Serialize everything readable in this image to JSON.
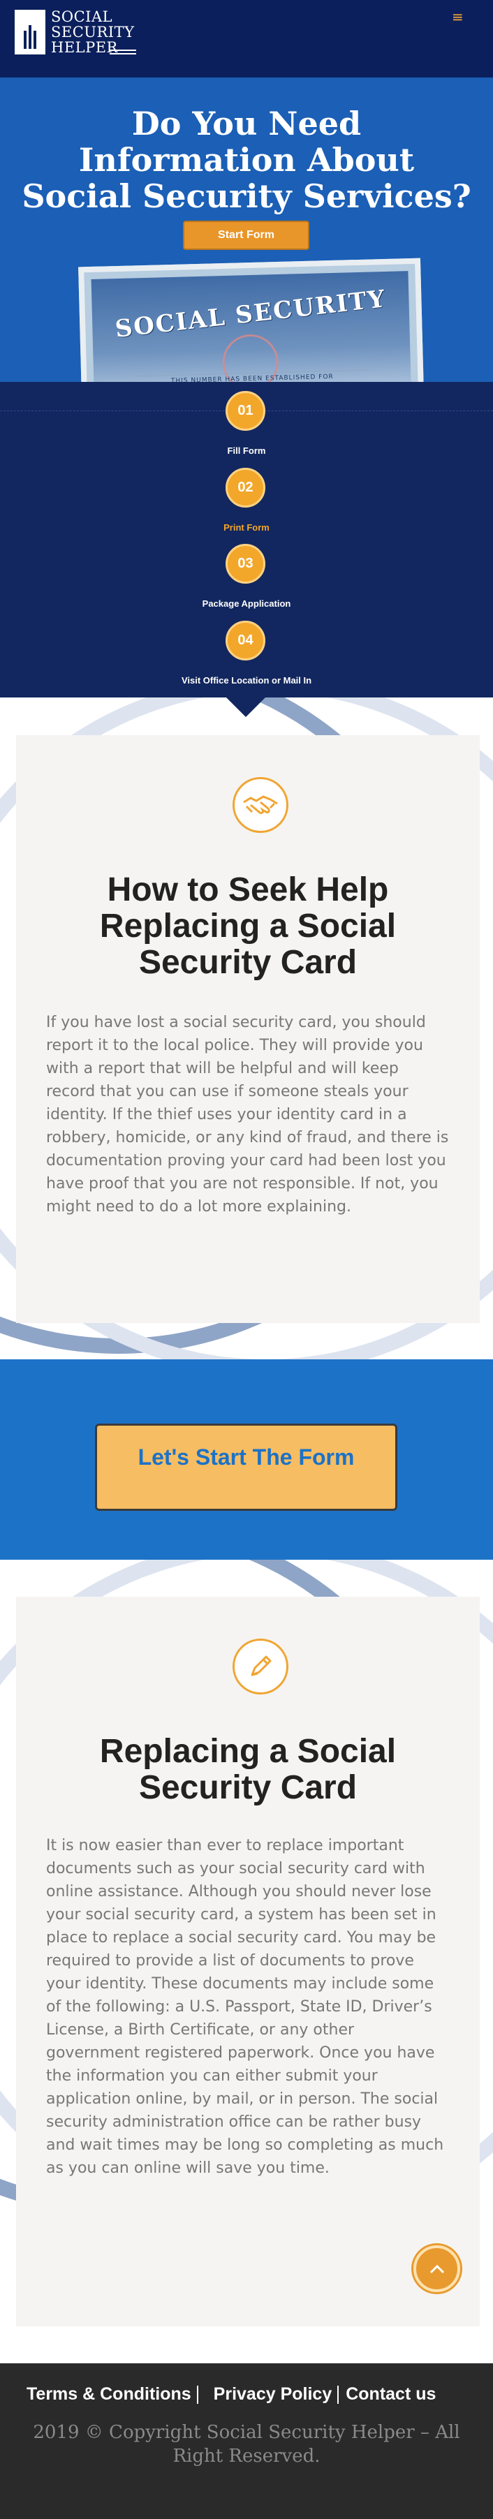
{
  "header": {
    "logo_line1": "SOCIAL",
    "logo_line2": "SECURITY",
    "logo_line3": "HELPER",
    "menu_icon": "≡"
  },
  "hero": {
    "title": "Do You Need Information About Social Security Services?",
    "start_button": "Start Form",
    "card_title": "SOCIAL SECURITY",
    "card_text": "THIS NUMBER HAS BEEN ESTABLISHED FOR"
  },
  "steps": [
    {
      "number": "01",
      "label": "Fill Form",
      "active": false
    },
    {
      "number": "02",
      "label": "Print Form",
      "active": true
    },
    {
      "number": "03",
      "label": "Package Application",
      "active": false
    },
    {
      "number": "04",
      "label": "Visit Office Location or Mail In",
      "active": false
    }
  ],
  "section1": {
    "icon": "handshake-icon",
    "title": "How to Seek Help Replacing a Social Security Card",
    "body": "If you have lost a social security card, you should report it to the local police. They will provide you with a report that will be helpful and will keep record that you can use if someone steals your identity. If the thief uses your identity card in a robbery, homicide, or any kind of fraud, and there is documentation proving your card had been lost you have proof that you are not responsible. If not, you might need to do a lot more explaining."
  },
  "cta": {
    "button": "Let's Start The Form"
  },
  "section2": {
    "icon": "pen-icon",
    "title": "Replacing a Social Security Card",
    "body": "It is now easier than ever to replace important documents such as your social security card with online assistance. Although you should never lose your social security card, a system has been set in place to replace a social security card. You may be required to provide a list of documents to prove your identity. These documents may include some of the following: a U.S. Passport, State ID, Driver’s License, a Birth Certificate, or any other government registered paperwork. Once you have the information you can either submit your application online, by mail, or in person. The social security administration office can be rather busy and wait times may be long so completing as much as you can online will save you time."
  },
  "footer": {
    "links": [
      "Terms & Conditions",
      "Privacy Policy",
      "Contact us"
    ],
    "copyright": "2019 © Copyright Social Security Helper – All Right Reserved."
  },
  "colors": {
    "navy": "#0b1f5c",
    "hero_blue": "#1b5fb6",
    "steps_navy": "#12275f",
    "accent_orange": "#f2a72b",
    "cta_blue": "#1c72c7",
    "footer_dark": "#2a2a2a"
  }
}
